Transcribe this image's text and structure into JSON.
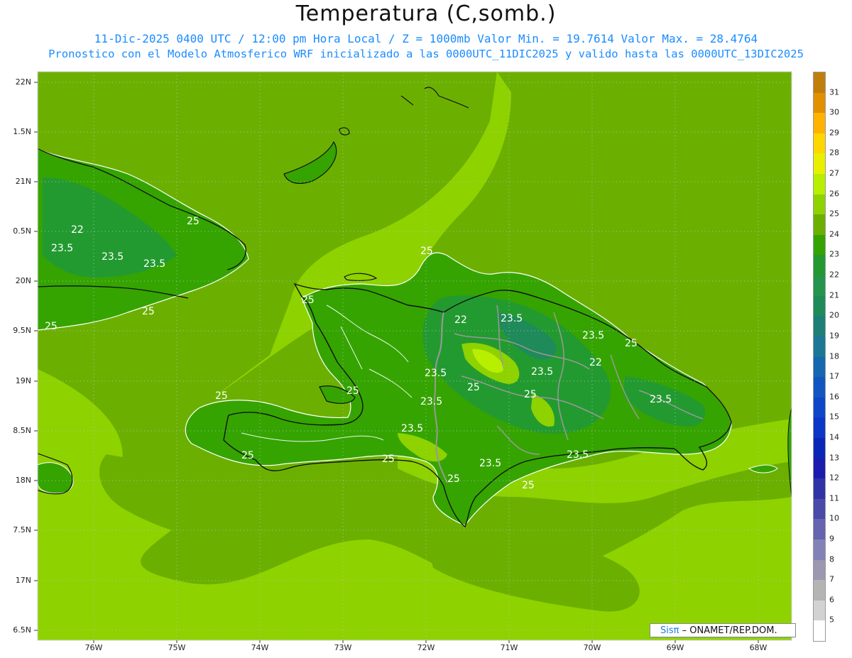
{
  "title": "Temperatura (C,somb.)",
  "subtitle_line1": "11-Dic-2025 0400 UTC / 12:00 pm Hora Local / Z = 1000mb  Valor Min. = 19.7614  Valor Max. = 28.4764",
  "subtitle_line2": "Pronostico con el Modelo Atmosferico WRF inicializado a las 0000UTC_11DIC2025 y valido hasta las  0000UTC_13DIC2025",
  "lat_labels": [
    "22N",
    "1.5N",
    "21N",
    "0.5N",
    "20N",
    "9.5N",
    "19N",
    "8.5N",
    "18N",
    "7.5N",
    "17N",
    "6.5N"
  ],
  "lon_labels": [
    "76W",
    "75W",
    "74W",
    "73W",
    "72W",
    "71W",
    "70W",
    "69W",
    "68W"
  ],
  "colorbar": {
    "labels": [
      "31",
      "30",
      "29",
      "28",
      "27",
      "26",
      "25",
      "24",
      "23",
      "22",
      "21",
      "20",
      "19",
      "18",
      "17",
      "16",
      "15",
      "14",
      "13",
      "12",
      "11",
      "10",
      "9",
      "8",
      "7",
      "6",
      "5"
    ],
    "colors": [
      "#c27e0a",
      "#e29000",
      "#ffb300",
      "#ffd600",
      "#e8f000",
      "#b8ee00",
      "#8ed200",
      "#6bb000",
      "#35a400",
      "#239a30",
      "#27944c",
      "#1f8a5a",
      "#1d7f78",
      "#1a7896",
      "#1567b0",
      "#1255c2",
      "#0f45c8",
      "#0b36c8",
      "#0a26b8",
      "#1c1cae",
      "#3232a8",
      "#4a4aa8",
      "#6464b0",
      "#8282b8",
      "#9c98b0",
      "#b4b4b4",
      "#d2d2d2",
      "#ffffff"
    ]
  },
  "contour_labels": [
    "22",
    "23.5",
    "23.5",
    "25",
    "25",
    "25",
    "25",
    "25",
    "22",
    "23.5",
    "23.5",
    "25",
    "23.5",
    "22",
    "23.5",
    "25",
    "23.5",
    "23.5",
    "23.5",
    "25",
    "25",
    "23.5",
    "25",
    "23.5",
    "25",
    "25",
    "25",
    "23.5",
    "25"
  ],
  "credit": {
    "sis": "Sisπ",
    "rest": " – ONAMET/REP.DOM."
  }
}
